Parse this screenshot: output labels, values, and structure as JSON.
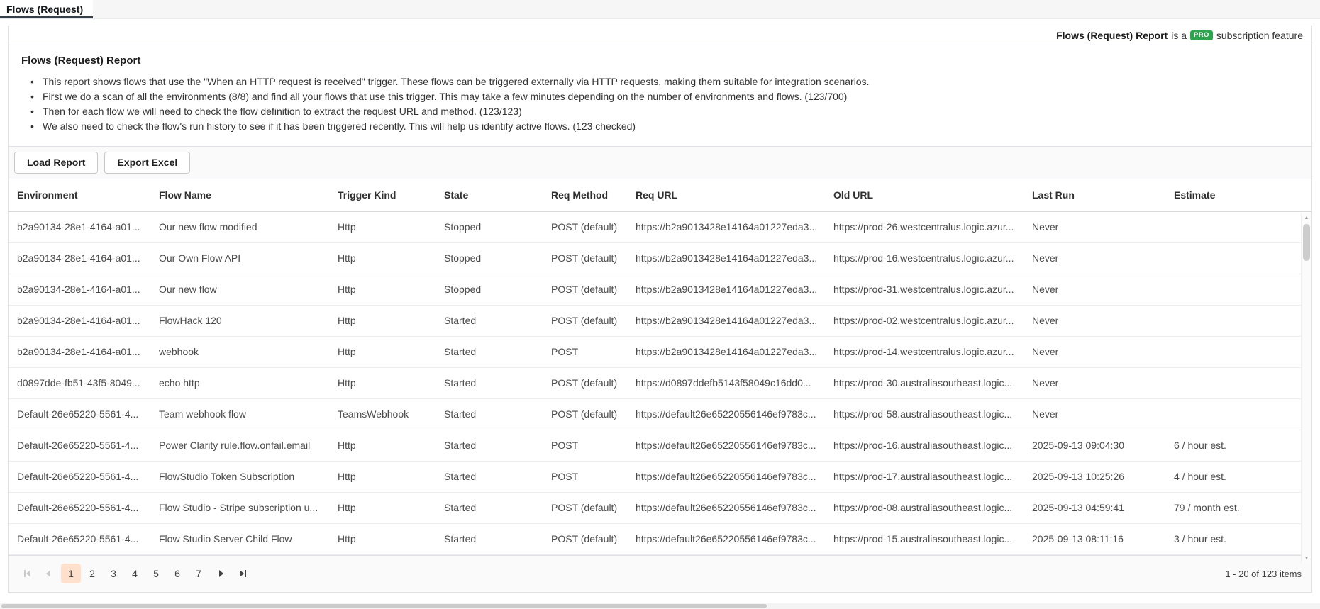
{
  "tab": {
    "label": "Flows (Request)"
  },
  "pro_banner": {
    "feature_name": "Flows (Request) Report",
    "text_before_badge": "is a",
    "badge": "PRO",
    "badge_color": "#2ea44f",
    "text_after_badge": "subscription feature"
  },
  "report": {
    "title": "Flows (Request) Report",
    "bullets": [
      "This report shows flows that use the \"When an HTTP request is received\" trigger. These flows can be triggered externally via HTTP requests, making them suitable for integration scenarios.",
      "First we do a scan of all the environments (8/8) and find all your flows that use this trigger. This may take a few minutes depending on the number of environments and flows. (123/700)",
      "Then for each flow we will need to check the flow definition to extract the request URL and method. (123/123)",
      "We also need to check the flow's run history to see if it has been triggered recently. This will help us identify active flows. (123 checked)"
    ]
  },
  "toolbar": {
    "load_report_label": "Load Report",
    "export_excel_label": "Export Excel"
  },
  "table": {
    "columns": [
      "Environment",
      "Flow Name",
      "Trigger Kind",
      "State",
      "Req Method",
      "Req URL",
      "Old URL",
      "Last Run",
      "Estimate"
    ],
    "rows": [
      {
        "environment": "b2a90134-28e1-4164-a01...",
        "flow_name": "Our new flow modified",
        "trigger_kind": "Http",
        "state": "Stopped",
        "req_method": "POST (default)",
        "req_url": "https://b2a9013428e14164a01227eda3...",
        "old_url": "https://prod-26.westcentralus.logic.azur...",
        "last_run": "Never",
        "estimate": ""
      },
      {
        "environment": "b2a90134-28e1-4164-a01...",
        "flow_name": "Our Own Flow API",
        "trigger_kind": "Http",
        "state": "Stopped",
        "req_method": "POST (default)",
        "req_url": "https://b2a9013428e14164a01227eda3...",
        "old_url": "https://prod-16.westcentralus.logic.azur...",
        "last_run": "Never",
        "estimate": ""
      },
      {
        "environment": "b2a90134-28e1-4164-a01...",
        "flow_name": "Our new flow",
        "trigger_kind": "Http",
        "state": "Stopped",
        "req_method": "POST (default)",
        "req_url": "https://b2a9013428e14164a01227eda3...",
        "old_url": "https://prod-31.westcentralus.logic.azur...",
        "last_run": "Never",
        "estimate": ""
      },
      {
        "environment": "b2a90134-28e1-4164-a01...",
        "flow_name": "FlowHack 120",
        "trigger_kind": "Http",
        "state": "Started",
        "req_method": "POST (default)",
        "req_url": "https://b2a9013428e14164a01227eda3...",
        "old_url": "https://prod-02.westcentralus.logic.azur...",
        "last_run": "Never",
        "estimate": ""
      },
      {
        "environment": "b2a90134-28e1-4164-a01...",
        "flow_name": "webhook",
        "trigger_kind": "Http",
        "state": "Started",
        "req_method": "POST",
        "req_url": "https://b2a9013428e14164a01227eda3...",
        "old_url": "https://prod-14.westcentralus.logic.azur...",
        "last_run": "Never",
        "estimate": ""
      },
      {
        "environment": "d0897dde-fb51-43f5-8049...",
        "flow_name": "echo http",
        "trigger_kind": "Http",
        "state": "Started",
        "req_method": "POST (default)",
        "req_url": "https://d0897ddefb5143f58049c16dd0...",
        "old_url": "https://prod-30.australiasoutheast.logic...",
        "last_run": "Never",
        "estimate": ""
      },
      {
        "environment": "Default-26e65220-5561-4...",
        "flow_name": "Team webhook flow",
        "trigger_kind": "TeamsWebhook",
        "state": "Started",
        "req_method": "POST (default)",
        "req_url": "https://default26e65220556146ef9783c...",
        "old_url": "https://prod-58.australiasoutheast.logic...",
        "last_run": "Never",
        "estimate": ""
      },
      {
        "environment": "Default-26e65220-5561-4...",
        "flow_name": "Power Clarity rule.flow.onfail.email",
        "trigger_kind": "Http",
        "state": "Started",
        "req_method": "POST",
        "req_url": "https://default26e65220556146ef9783c...",
        "old_url": "https://prod-16.australiasoutheast.logic...",
        "last_run": "2025-09-13 09:04:30",
        "estimate": "6 / hour est."
      },
      {
        "environment": "Default-26e65220-5561-4...",
        "flow_name": "FlowStudio Token Subscription",
        "trigger_kind": "Http",
        "state": "Started",
        "req_method": "POST",
        "req_url": "https://default26e65220556146ef9783c...",
        "old_url": "https://prod-17.australiasoutheast.logic...",
        "last_run": "2025-09-13 10:25:26",
        "estimate": "4 / hour est."
      },
      {
        "environment": "Default-26e65220-5561-4...",
        "flow_name": "Flow Studio - Stripe subscription u...",
        "trigger_kind": "Http",
        "state": "Started",
        "req_method": "POST (default)",
        "req_url": "https://default26e65220556146ef9783c...",
        "old_url": "https://prod-08.australiasoutheast.logic...",
        "last_run": "2025-09-13 04:59:41",
        "estimate": "79 / month est."
      },
      {
        "environment": "Default-26e65220-5561-4...",
        "flow_name": "Flow Studio Server Child Flow",
        "trigger_kind": "Http",
        "state": "Started",
        "req_method": "POST (default)",
        "req_url": "https://default26e65220556146ef9783c...",
        "old_url": "https://prod-15.australiasoutheast.logic...",
        "last_run": "2025-09-13 08:11:16",
        "estimate": "3 / hour est."
      }
    ]
  },
  "pager": {
    "pages": [
      "1",
      "2",
      "3",
      "4",
      "5",
      "6",
      "7"
    ],
    "current_page": "1",
    "info": "1 - 20 of 123 items"
  }
}
